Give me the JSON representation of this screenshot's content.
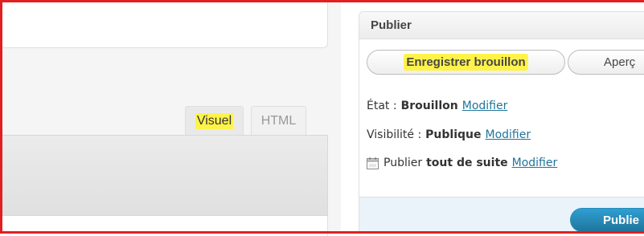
{
  "editor": {
    "tabs": [
      {
        "label": "Visuel",
        "active": true,
        "highlighted": true
      },
      {
        "label": "HTML",
        "active": false
      }
    ]
  },
  "publish_box": {
    "title": "Publier",
    "save_draft_label": "Enregistrer brouillon",
    "preview_label": "Aperç",
    "status": {
      "label": "État :",
      "value": "Brouillon",
      "edit_link": "Modifier"
    },
    "visibility": {
      "label": "Visibilité :",
      "value": "Publique",
      "edit_link": "Modifier"
    },
    "schedule": {
      "label": "Publier",
      "value": "tout de suite",
      "edit_link": "Modifier",
      "icon": "calendar-icon"
    },
    "publish_label": "Publie"
  },
  "colors": {
    "highlight": "#fff34a",
    "frame_border": "#e02020",
    "link": "#21759b",
    "publish_button": "#21759b"
  }
}
